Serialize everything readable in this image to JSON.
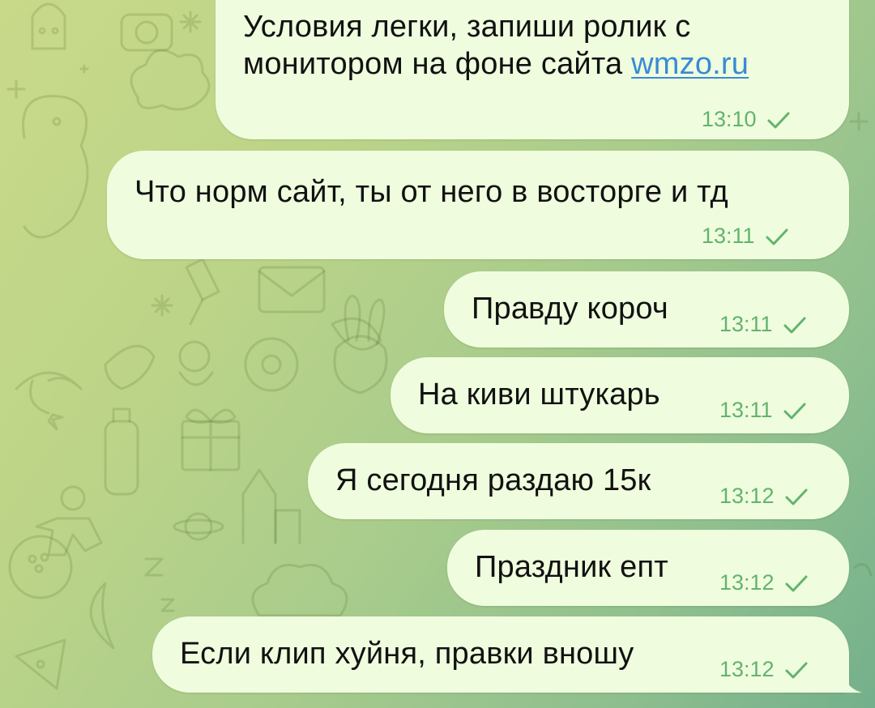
{
  "messages": [
    {
      "text": "Условия легки, запиши ролик с",
      "text2": "монитором на фоне сайта ",
      "link": "wmzo.ru",
      "time": "13:10",
      "status": "sent"
    },
    {
      "text": "Что норм сайт, ты от него в восторге и тд",
      "time": "13:11",
      "status": "sent"
    },
    {
      "text": "Правду короч",
      "time": "13:11",
      "status": "sent"
    },
    {
      "text": "На киви штукарь",
      "time": "13:11",
      "status": "sent"
    },
    {
      "text": "Я сегодня раздаю 15к",
      "time": "13:12",
      "status": "sent"
    },
    {
      "text": "Праздник епт",
      "time": "13:12",
      "status": "sent"
    },
    {
      "text": "Если клип хуйня, правки вношу",
      "time": "13:12",
      "status": "sent"
    }
  ],
  "icons": {
    "status": "check-icon",
    "background": "doodle-pattern"
  },
  "colors": {
    "bubble": "#effdde",
    "text": "#111111",
    "meta": "#63b36d",
    "link": "#3a8ad4",
    "background_start": "#c9d98a",
    "background_end": "#74b08c"
  }
}
